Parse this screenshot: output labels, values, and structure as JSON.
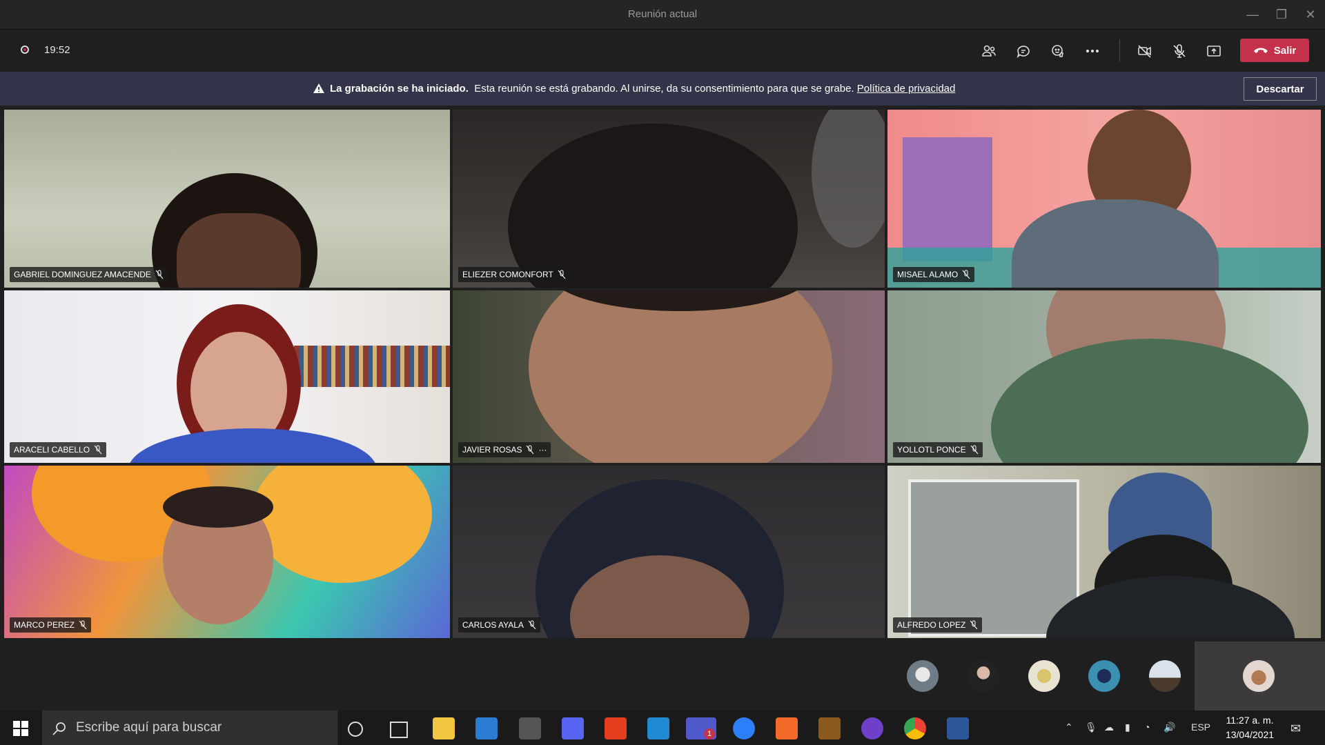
{
  "window": {
    "title": "Reunión actual"
  },
  "toolbar": {
    "timer": "19:52",
    "leave_label": "Salir"
  },
  "banner": {
    "bold": "La grabación se ha iniciado.",
    "message": "Esta reunión se está grabando. Al unirse, da su consentimiento para que se grabe.",
    "link": "Política de privacidad",
    "dismiss_label": "Descartar",
    "color": "#33344a"
  },
  "participants": [
    {
      "name": "GABRIEL DOMINGUEZ AMACENDE",
      "muted": true
    },
    {
      "name": "ELIEZER COMONFORT",
      "muted": true
    },
    {
      "name": "MISAEL ALAMO",
      "muted": true
    },
    {
      "name": "ARACELI CABELLO",
      "muted": true
    },
    {
      "name": "JAVIER ROSAS",
      "muted": true,
      "more": "···"
    },
    {
      "name": "YOLLOTL PONCE",
      "muted": true
    },
    {
      "name": "MARCO PEREZ",
      "muted": true
    },
    {
      "name": "CARLOS AYALA",
      "muted": true
    },
    {
      "name": "ALFREDO LOPEZ",
      "muted": true
    }
  ],
  "taskbar": {
    "search_placeholder": "Escribe aquí para buscar",
    "teams_badge": "1",
    "language": "ESP",
    "time": "11:27 a. m.",
    "date": "13/04/2021"
  },
  "colors": {
    "accent_leave": "#c4314b",
    "background": "#1f1f1f"
  }
}
